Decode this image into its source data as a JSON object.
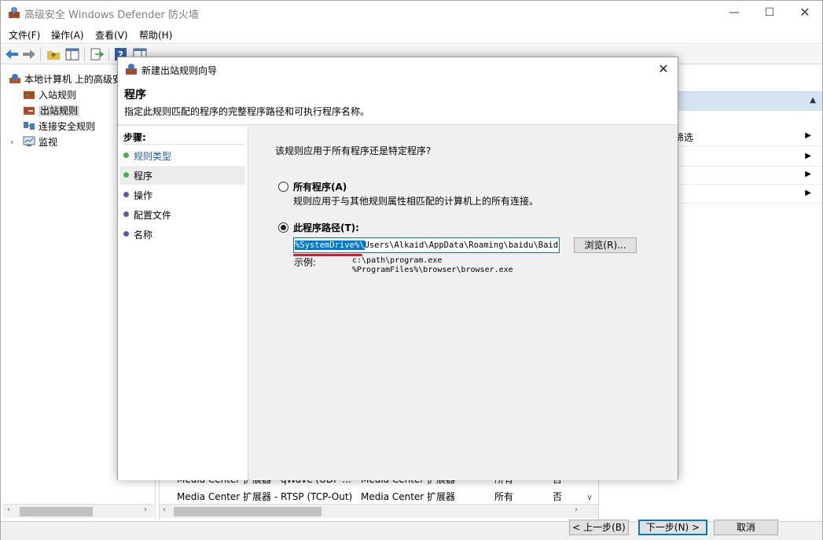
{
  "main": {
    "title": "高级安全 Windows Defender 防火墙",
    "window_controls": {
      "minimize": "—",
      "maximize": "☐",
      "close": "✕"
    },
    "menu": [
      "文件(F)",
      "操作(A)",
      "查看(V)",
      "帮助(H)"
    ],
    "tree": {
      "root": "本地计算机 上的高级安",
      "items": [
        "入站规则",
        "出站规则",
        "连接安全规则",
        "监视"
      ],
      "selected": "出站规则"
    },
    "list_rows": [
      {
        "name": "Media Center 扩展器 - qWave (UDP-...",
        "group": "Media Center 扩展器",
        "profile": "所有",
        "enabled": "否"
      },
      {
        "name": "Media Center 扩展器 - RTSP (TCP-Out)",
        "group": "Media Center 扩展器",
        "profile": "所有",
        "enabled": "否"
      }
    ],
    "actions_partial": "筛选"
  },
  "dialog": {
    "title": "新建出站规则向导",
    "close_glyph": "✕",
    "header_title": "程序",
    "header_subtitle": "指定此规则匹配的程序的完整程序路径和可执行程序名称。",
    "steps_title": "步骤:",
    "steps": [
      {
        "label": "规则类型",
        "state": "done"
      },
      {
        "label": "程序",
        "state": "current"
      },
      {
        "label": "操作",
        "state": "todo"
      },
      {
        "label": "配置文件",
        "state": "todo"
      },
      {
        "label": "名称",
        "state": "todo"
      }
    ],
    "question": "该规则应用于所有程序还是特定程序?",
    "option_all": {
      "label": "所有程序(A)",
      "desc": "规则应用于与其他规则属性相匹配的计算机上的所有连接。",
      "checked": false
    },
    "option_path": {
      "label": "此程序路径(T):",
      "checked": true,
      "value_selected": "%SystemDrive%\\",
      "value_rest": "Users\\Alkaid\\AppData\\Roaming\\baidu\\BaiduNe"
    },
    "browse_label": "浏览(R)...",
    "example_label": "示例:",
    "examples": [
      "c:\\path\\program.exe",
      "%ProgramFiles%\\browser\\browser.exe"
    ],
    "buttons": {
      "back": "< 上一步(B)",
      "next": "下一步(N) >",
      "cancel": "取消"
    }
  },
  "colors": {
    "accent_blue": "#0078d7",
    "step_done_dot": "#4caf50",
    "step_todo_dot": "#5a5ab4",
    "annotation_red": "#d91a2a",
    "actions_header": "#d5e3f3"
  }
}
